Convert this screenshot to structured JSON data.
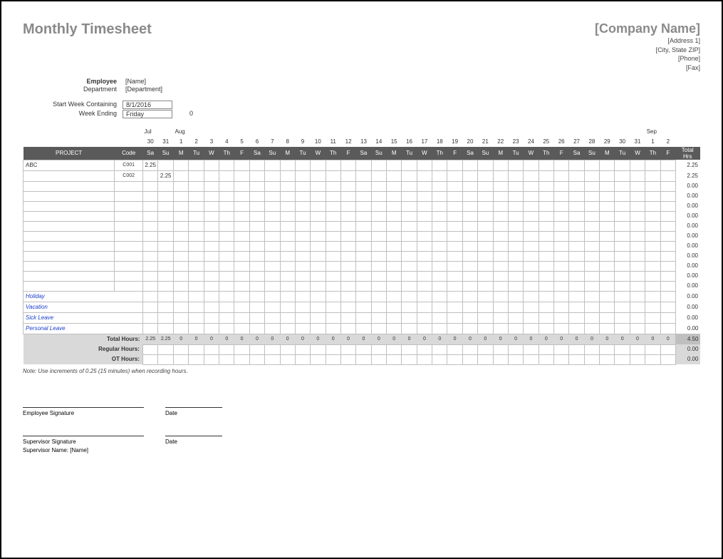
{
  "title": "Monthly Timesheet",
  "company": {
    "name": "[Company Name]",
    "addr1": "[Address 1]",
    "addr2": "[City, State ZIP]",
    "phone": "[Phone]",
    "fax": "[Fax]"
  },
  "employee": {
    "label": "Employee",
    "value": "[Name]"
  },
  "department": {
    "label": "Department",
    "value": "[Department]"
  },
  "startWeek": {
    "label": "Start Week Containing",
    "value": "8/1/2016"
  },
  "weekEnding": {
    "label": "Week Ending",
    "value": "Friday",
    "zero": "0"
  },
  "headers": {
    "project": "PROJECT",
    "code": "Code",
    "total": "Total\nHrs"
  },
  "months": {
    "jul": "Jul",
    "aug": "Aug",
    "sep": "Sep"
  },
  "dates": [
    "30",
    "31",
    "1",
    "2",
    "3",
    "4",
    "5",
    "6",
    "7",
    "8",
    "9",
    "10",
    "11",
    "12",
    "13",
    "14",
    "15",
    "16",
    "17",
    "18",
    "19",
    "20",
    "21",
    "22",
    "23",
    "24",
    "25",
    "26",
    "27",
    "28",
    "29",
    "30",
    "31",
    "1",
    "2"
  ],
  "days": [
    "Sa",
    "Su",
    "M",
    "Tu",
    "W",
    "Th",
    "F",
    "Sa",
    "Su",
    "M",
    "Tu",
    "W",
    "Th",
    "F",
    "Sa",
    "Su",
    "M",
    "Tu",
    "W",
    "Th",
    "F",
    "Sa",
    "Su",
    "M",
    "Tu",
    "W",
    "Th",
    "F",
    "Sa",
    "Su",
    "M",
    "Tu",
    "W",
    "Th",
    "F"
  ],
  "rows": [
    {
      "project": "ABC",
      "code": "C001",
      "cells": [
        "2.25",
        "",
        "",
        "",
        "",
        "",
        "",
        "",
        "",
        "",
        "",
        "",
        "",
        "",
        "",
        "",
        "",
        "",
        "",
        "",
        "",
        "",
        "",
        "",
        "",
        "",
        "",
        "",
        "",
        "",
        "",
        "",
        "",
        "",
        ""
      ],
      "total": "2.25"
    },
    {
      "project": "",
      "code": "C002",
      "cells": [
        "",
        "2.25",
        "",
        "",
        "",
        "",
        "",
        "",
        "",
        "",
        "",
        "",
        "",
        "",
        "",
        "",
        "",
        "",
        "",
        "",
        "",
        "",
        "",
        "",
        "",
        "",
        "",
        "",
        "",
        "",
        "",
        "",
        "",
        "",
        ""
      ],
      "total": "2.25"
    },
    {
      "project": "",
      "code": "",
      "cells": [
        "",
        "",
        "",
        "",
        "",
        "",
        "",
        "",
        "",
        "",
        "",
        "",
        "",
        "",
        "",
        "",
        "",
        "",
        "",
        "",
        "",
        "",
        "",
        "",
        "",
        "",
        "",
        "",
        "",
        "",
        "",
        "",
        "",
        "",
        ""
      ],
      "total": "0.00"
    },
    {
      "project": "",
      "code": "",
      "cells": [
        "",
        "",
        "",
        "",
        "",
        "",
        "",
        "",
        "",
        "",
        "",
        "",
        "",
        "",
        "",
        "",
        "",
        "",
        "",
        "",
        "",
        "",
        "",
        "",
        "",
        "",
        "",
        "",
        "",
        "",
        "",
        "",
        "",
        "",
        ""
      ],
      "total": "0.00"
    },
    {
      "project": "",
      "code": "",
      "cells": [
        "",
        "",
        "",
        "",
        "",
        "",
        "",
        "",
        "",
        "",
        "",
        "",
        "",
        "",
        "",
        "",
        "",
        "",
        "",
        "",
        "",
        "",
        "",
        "",
        "",
        "",
        "",
        "",
        "",
        "",
        "",
        "",
        "",
        "",
        ""
      ],
      "total": "0.00"
    },
    {
      "project": "",
      "code": "",
      "cells": [
        "",
        "",
        "",
        "",
        "",
        "",
        "",
        "",
        "",
        "",
        "",
        "",
        "",
        "",
        "",
        "",
        "",
        "",
        "",
        "",
        "",
        "",
        "",
        "",
        "",
        "",
        "",
        "",
        "",
        "",
        "",
        "",
        "",
        "",
        ""
      ],
      "total": "0.00"
    },
    {
      "project": "",
      "code": "",
      "cells": [
        "",
        "",
        "",
        "",
        "",
        "",
        "",
        "",
        "",
        "",
        "",
        "",
        "",
        "",
        "",
        "",
        "",
        "",
        "",
        "",
        "",
        "",
        "",
        "",
        "",
        "",
        "",
        "",
        "",
        "",
        "",
        "",
        "",
        "",
        ""
      ],
      "total": "0.00"
    },
    {
      "project": "",
      "code": "",
      "cells": [
        "",
        "",
        "",
        "",
        "",
        "",
        "",
        "",
        "",
        "",
        "",
        "",
        "",
        "",
        "",
        "",
        "",
        "",
        "",
        "",
        "",
        "",
        "",
        "",
        "",
        "",
        "",
        "",
        "",
        "",
        "",
        "",
        "",
        "",
        ""
      ],
      "total": "0.00"
    },
    {
      "project": "",
      "code": "",
      "cells": [
        "",
        "",
        "",
        "",
        "",
        "",
        "",
        "",
        "",
        "",
        "",
        "",
        "",
        "",
        "",
        "",
        "",
        "",
        "",
        "",
        "",
        "",
        "",
        "",
        "",
        "",
        "",
        "",
        "",
        "",
        "",
        "",
        "",
        "",
        ""
      ],
      "total": "0.00"
    },
    {
      "project": "",
      "code": "",
      "cells": [
        "",
        "",
        "",
        "",
        "",
        "",
        "",
        "",
        "",
        "",
        "",
        "",
        "",
        "",
        "",
        "",
        "",
        "",
        "",
        "",
        "",
        "",
        "",
        "",
        "",
        "",
        "",
        "",
        "",
        "",
        "",
        "",
        "",
        "",
        ""
      ],
      "total": "0.00"
    },
    {
      "project": "",
      "code": "",
      "cells": [
        "",
        "",
        "",
        "",
        "",
        "",
        "",
        "",
        "",
        "",
        "",
        "",
        "",
        "",
        "",
        "",
        "",
        "",
        "",
        "",
        "",
        "",
        "",
        "",
        "",
        "",
        "",
        "",
        "",
        "",
        "",
        "",
        "",
        "",
        ""
      ],
      "total": "0.00"
    },
    {
      "project": "",
      "code": "",
      "cells": [
        "",
        "",
        "",
        "",
        "",
        "",
        "",
        "",
        "",
        "",
        "",
        "",
        "",
        "",
        "",
        "",
        "",
        "",
        "",
        "",
        "",
        "",
        "",
        "",
        "",
        "",
        "",
        "",
        "",
        "",
        "",
        "",
        "",
        "",
        ""
      ],
      "total": "0.00"
    },
    {
      "project": "",
      "code": "",
      "cells": [
        "",
        "",
        "",
        "",
        "",
        "",
        "",
        "",
        "",
        "",
        "",
        "",
        "",
        "",
        "",
        "",
        "",
        "",
        "",
        "",
        "",
        "",
        "",
        "",
        "",
        "",
        "",
        "",
        "",
        "",
        "",
        "",
        "",
        "",
        ""
      ],
      "total": "0.00"
    }
  ],
  "specialRows": [
    {
      "label": "Holiday",
      "cells": [],
      "total": "0.00"
    },
    {
      "label": "Vacation",
      "cells": [],
      "total": "0.00"
    },
    {
      "label": "Sick Leave",
      "cells": [],
      "total": "0.00"
    },
    {
      "label": "Personal Leave",
      "cells": [],
      "total": "0.00"
    }
  ],
  "totals": {
    "label": "Total Hours:",
    "cells": [
      "2.25",
      "2.25",
      "0",
      "0",
      "0",
      "0",
      "0",
      "0",
      "0",
      "0",
      "0",
      "0",
      "0",
      "0",
      "0",
      "0",
      "0",
      "0",
      "0",
      "0",
      "0",
      "0",
      "0",
      "0",
      "0",
      "0",
      "0",
      "0",
      "0",
      "0",
      "0",
      "0",
      "0",
      "0",
      "0"
    ],
    "total": "4.50"
  },
  "regular": {
    "label": "Regular Hours:",
    "total": "0.00"
  },
  "ot": {
    "label": "OT Hours:",
    "total": "0.00"
  },
  "note": "Note: Use increments of 0.25 (15 minutes) when recording hours.",
  "sig": {
    "empSig": "Employee Signature",
    "date": "Date",
    "supSig": "Supervisor Signature",
    "supName": "Supervisor Name: [Name]"
  }
}
